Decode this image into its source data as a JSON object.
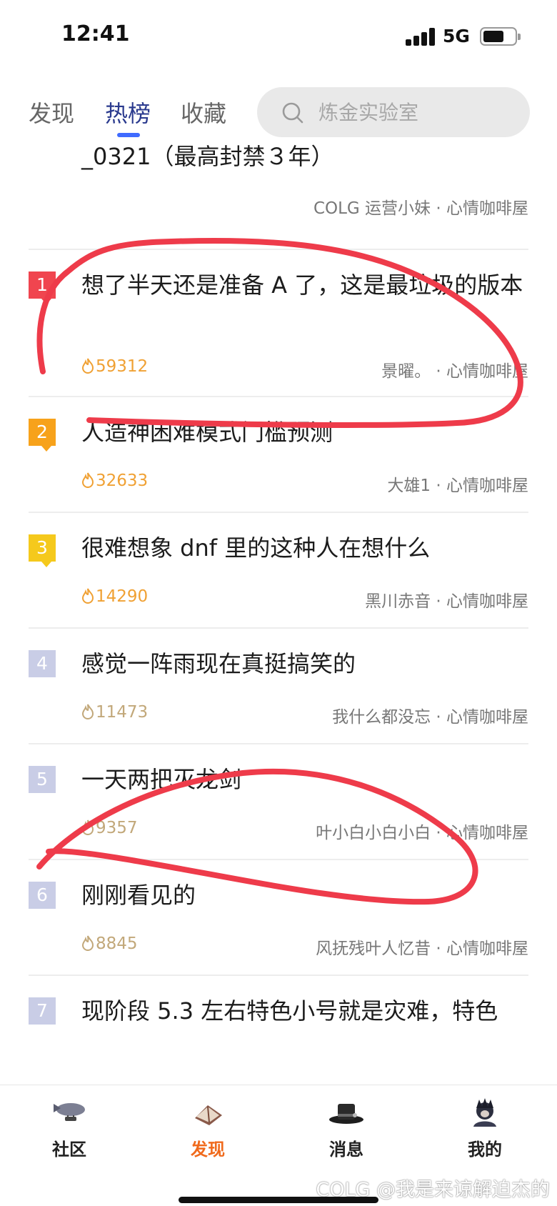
{
  "status_bar": {
    "time": "12:41",
    "network": "5G"
  },
  "top_tabs": [
    {
      "label": "发现",
      "active": false
    },
    {
      "label": "热榜",
      "active": true
    },
    {
      "label": "收藏",
      "active": false
    }
  ],
  "search": {
    "placeholder": "炼金实验室"
  },
  "feed": {
    "partial_item": {
      "title": "_0321（最高封禁３年）",
      "author": "COLG 运营小妹",
      "board": "心情咖啡屋"
    },
    "items": [
      {
        "rank": "1",
        "title": "想了半天还是准备 A 了，这是最垃圾的版本",
        "heat": "59312",
        "author": "景曜。",
        "board": "心情咖啡屋"
      },
      {
        "rank": "2",
        "title": "人造神困难模式门槛预测",
        "heat": "32633",
        "author": "大雄1",
        "board": "心情咖啡屋"
      },
      {
        "rank": "3",
        "title": "很难想象 dnf 里的这种人在想什么",
        "heat": "14290",
        "author": "黑川赤音",
        "board": "心情咖啡屋"
      },
      {
        "rank": "4",
        "title": "感觉一阵雨现在真挺搞笑的",
        "heat": "11473",
        "author": "我什么都没忘",
        "board": "心情咖啡屋"
      },
      {
        "rank": "5",
        "title": "一天两把灭龙剑",
        "heat": "9357",
        "author": "叶小白小白小白",
        "board": "心情咖啡屋"
      },
      {
        "rank": "6",
        "title": "刚刚看见的",
        "heat": "8845",
        "author": "风抚残叶人忆昔",
        "board": "心情咖啡屋"
      },
      {
        "rank": "7",
        "title": "现阶段 5.3 左右特色小号就是灾难，特色"
      }
    ],
    "separator": " · "
  },
  "bottom_nav": [
    {
      "label": "社区",
      "icon": "airship-icon",
      "active": false
    },
    {
      "label": "发现",
      "icon": "book-icon",
      "active": true
    },
    {
      "label": "消息",
      "icon": "top-hat-icon",
      "active": false
    },
    {
      "label": "我的",
      "icon": "avatar-icon",
      "active": false
    }
  ],
  "watermark": "COLG @我是来谅解迫杰的",
  "colors": {
    "rank1": "#f0454f",
    "rank2": "#f7a21b",
    "rank3": "#f5c91c",
    "rank_plain": "#c9cde6",
    "heat": "#f0a134",
    "active_nav": "#f06a1c",
    "annotation": "#ee3b4a"
  }
}
